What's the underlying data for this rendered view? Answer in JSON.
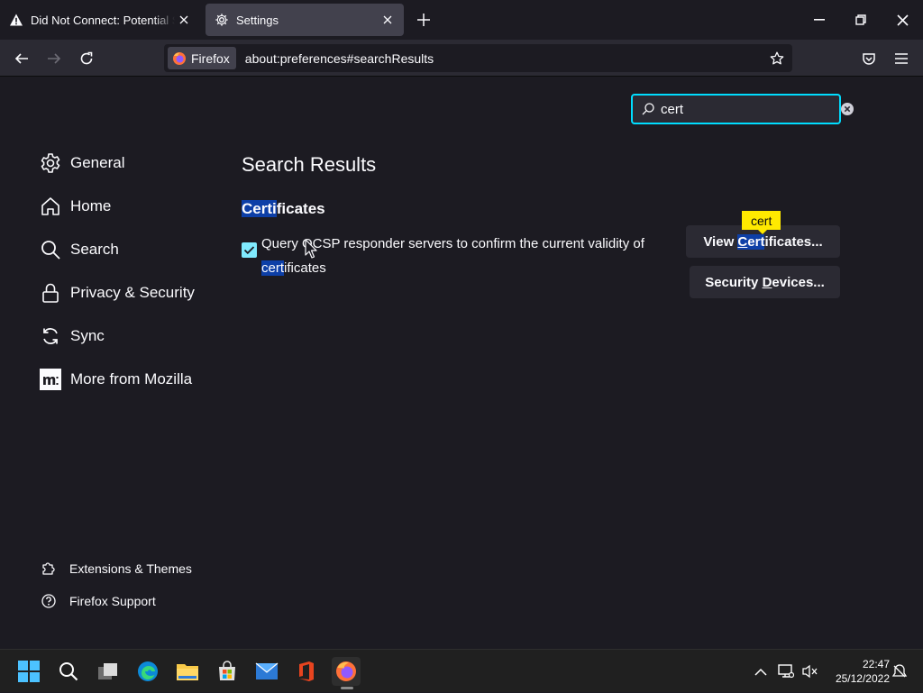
{
  "tabs": [
    {
      "title": "Did Not Connect: Potential Security Issue",
      "icon": "warning-icon"
    },
    {
      "title": "Settings",
      "icon": "gear-icon"
    }
  ],
  "navbar": {
    "identity_label": "Firefox",
    "url": "about:preferences#searchResults"
  },
  "search": {
    "value": "cert"
  },
  "sidebar": {
    "items": [
      {
        "label": "General",
        "icon": "gear-icon"
      },
      {
        "label": "Home",
        "icon": "home-icon"
      },
      {
        "label": "Search",
        "icon": "search-icon"
      },
      {
        "label": "Privacy & Security",
        "icon": "lock-icon"
      },
      {
        "label": "Sync",
        "icon": "sync-icon"
      },
      {
        "label": "More from Mozilla",
        "icon": "mozilla-icon"
      }
    ],
    "footer": [
      {
        "label": "Extensions & Themes",
        "icon": "puzzle-icon"
      },
      {
        "label": "Firefox Support",
        "icon": "help-icon"
      }
    ]
  },
  "main": {
    "results_title": "Search Results",
    "section": {
      "title_highlight": "Certi",
      "title_rest": "ficates"
    },
    "checkbox": {
      "checked": true,
      "label_part1": "Query OCSP responder servers to confirm the current validity of ",
      "label_highlight": "cert",
      "label_part2": "ificates"
    },
    "buttons": {
      "view_pre": "View ",
      "view_c": "C",
      "view_hl_rest": "ert",
      "view_post": "ificates...",
      "security_pre": "Security ",
      "security_d": "D",
      "security_post": "evices..."
    },
    "badge": "cert"
  },
  "taskbar": {
    "time": "22:47",
    "date": "25/12/2022"
  },
  "colors": {
    "background": "#1c1b22",
    "accent": "#00ddff",
    "highlight": "#0d3fa7",
    "badge": "#ffe900",
    "checkbox": "#80ebff"
  }
}
